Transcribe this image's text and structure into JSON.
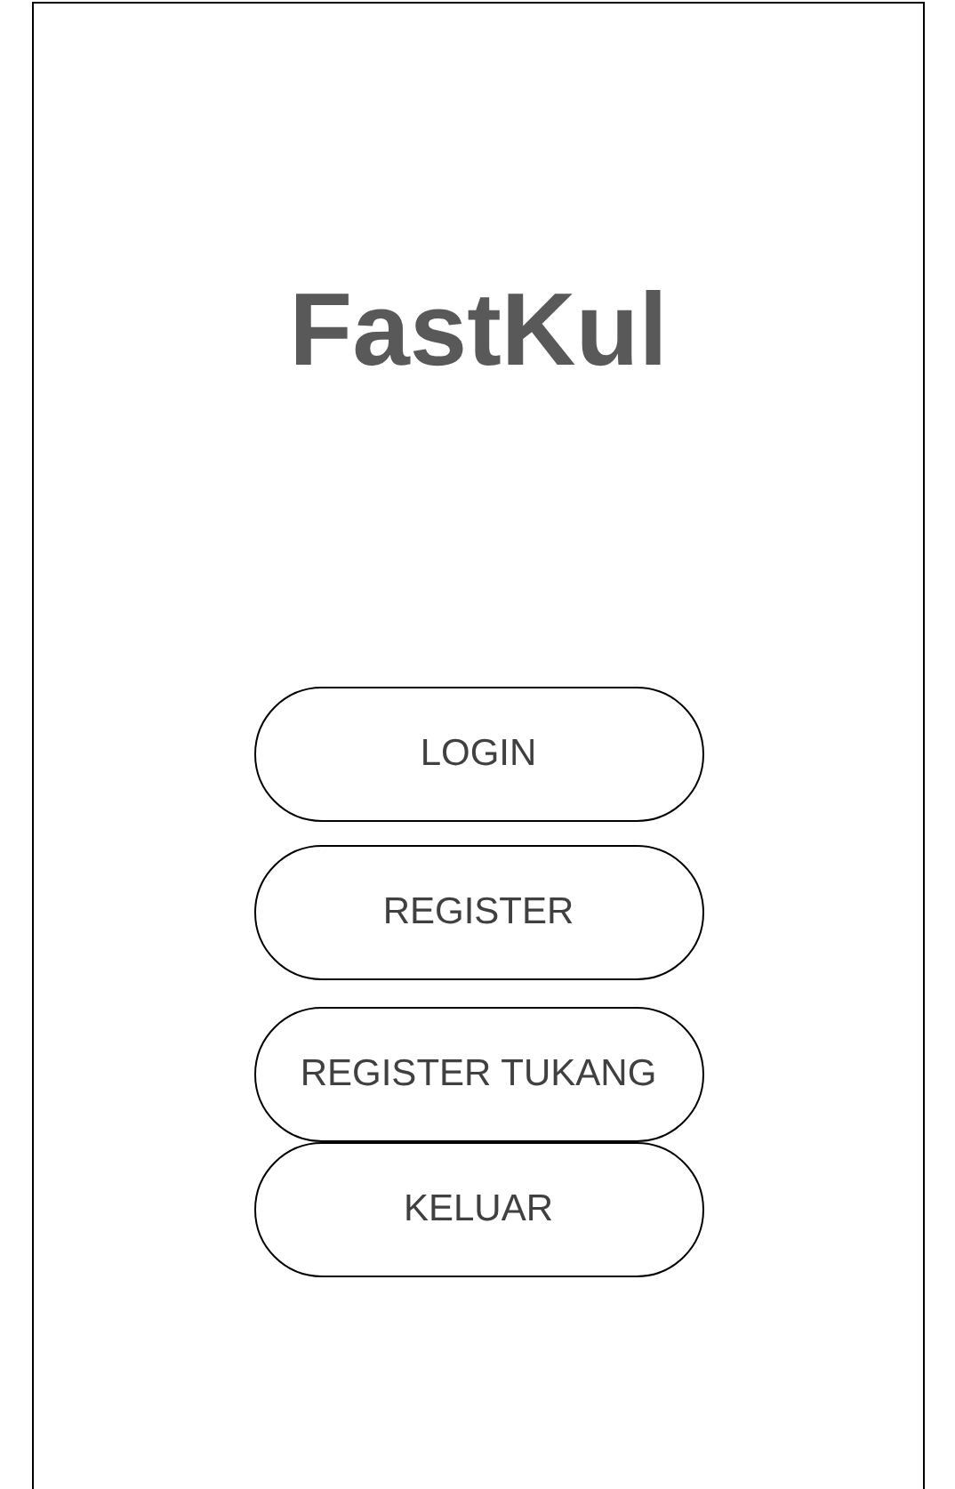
{
  "title": "FastKul",
  "buttons": [
    "LOGIN",
    "REGISTER",
    "REGISTER TUKANG",
    "KELUAR"
  ]
}
